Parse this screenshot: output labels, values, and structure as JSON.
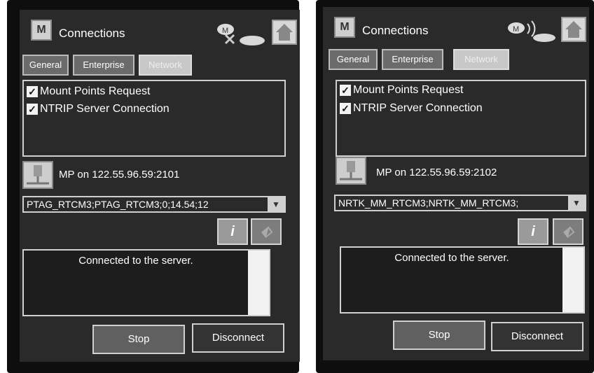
{
  "panels": [
    {
      "title": "Connections",
      "tabs": [
        "General",
        "Enterprise",
        "Network"
      ],
      "active_tab": "Network",
      "checkboxes": [
        {
          "label": "Mount Points Request",
          "checked": true
        },
        {
          "label": "NTRIP Server Connection",
          "checked": true
        }
      ],
      "mountpoint_label": "MP on 122.55.96.59:2101",
      "dropdown_value": "PTAG_RTCM3;PTAG_RTCM3;0;14.54;12",
      "message": "Connected to the server.",
      "buttons": {
        "stop": "Stop",
        "disconnect": "Disconnect"
      },
      "icons": [
        "app-m-icon",
        "satellite-x-icon",
        "antenna-icon",
        "home-icon",
        "mountpoint-icon",
        "info-icon",
        "map-icon"
      ]
    },
    {
      "title": "Connections",
      "tabs": [
        "General",
        "Enterprise",
        "Network"
      ],
      "active_tab": "Network",
      "checkboxes": [
        {
          "label": "Mount Points Request",
          "checked": true
        },
        {
          "label": "NTRIP Server Connection",
          "checked": true
        }
      ],
      "mountpoint_label": "MP on 122.55.96.59:2102",
      "dropdown_value": "NRTK_MM_RTCM3;NRTK_MM_RTCM3;",
      "message": "Connected to the server.",
      "buttons": {
        "stop": "Stop",
        "disconnect": "Disconnect"
      },
      "icons": [
        "app-m-icon",
        "satellite-signal-icon",
        "antenna-icon",
        "home-icon",
        "mountpoint-icon",
        "info-icon",
        "map-icon"
      ]
    }
  ]
}
